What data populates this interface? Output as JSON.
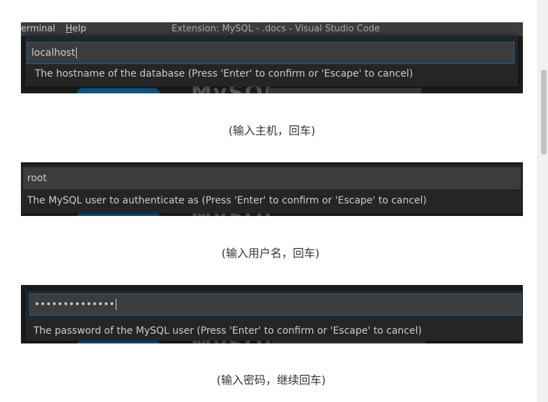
{
  "screenshots": [
    {
      "titlebar": {
        "menu_terminal": "erminal",
        "menu_help_mnemonic": "H",
        "menu_help_rest": "elp",
        "window_title": "Extension: MySQL - .docs - Visual Studio Code"
      },
      "input_value": "localhost",
      "message": "The hostname of the database (Press 'Enter' to confirm or 'Escape' to cancel)"
    },
    {
      "input_value": "root",
      "message": "The MySQL user to authenticate as (Press 'Enter' to confirm or 'Escape' to cancel)"
    },
    {
      "input_value": "••••••••••••••",
      "message": "The password of the MySQL user (Press 'Enter' to confirm or 'Escape' to cancel)"
    }
  ],
  "captions": [
    "(输入主机，回车)",
    "(输入用户名，回车)",
    "(输入密码，继续回车)"
  ],
  "background_ghost_text": "MySQL"
}
